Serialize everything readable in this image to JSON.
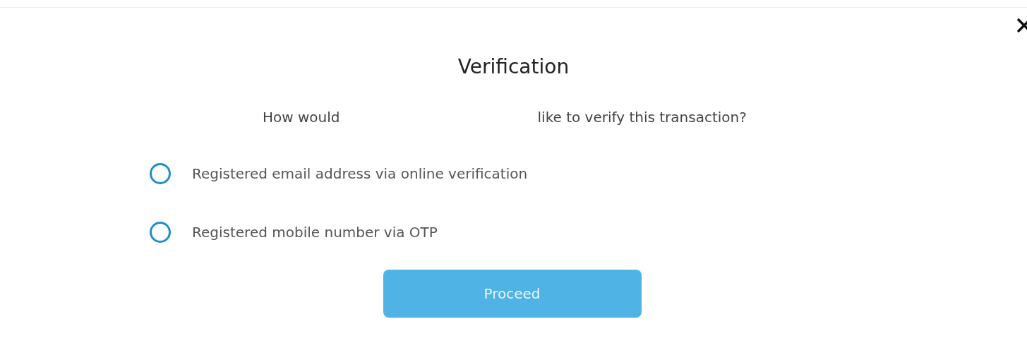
{
  "dialog": {
    "title": "Verification",
    "question": [
      "How would",
      "like to verify this transaction?"
    ],
    "options": [
      {
        "label": "Registered email address via online verification",
        "selected": false
      },
      {
        "label": "Registered mobile number via OTP",
        "selected": false
      }
    ],
    "button": "Proceed"
  }
}
